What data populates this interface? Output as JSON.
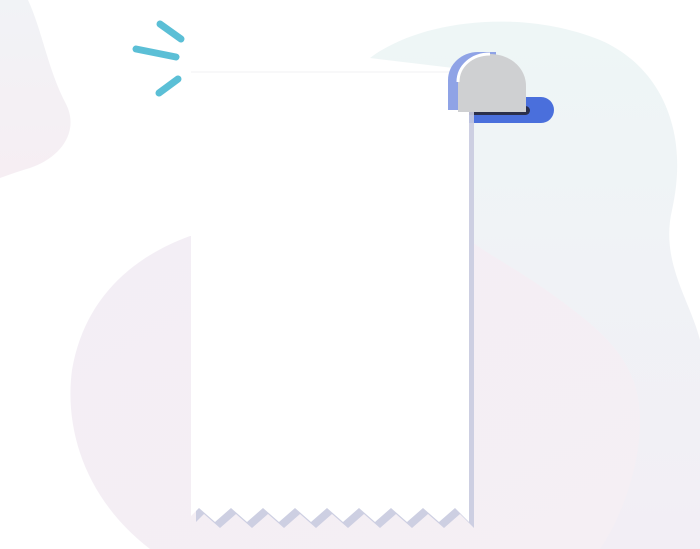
{
  "illustration": {
    "subject": "empty-receipt",
    "colors": {
      "background": "#ffffff",
      "blob_left": "#f3eef4",
      "blob_right": "#eef5f5",
      "blob_bottom": "#f4eef5",
      "receipt_paper": "#ffffff",
      "receipt_shadow": "#c9cbe0",
      "printer_slot": "#4a6fdc",
      "printer_slot_dark": "#2b2f4a",
      "printer_cap": "#cfd0d2",
      "printer_cap_back": "#8fa3e6",
      "spark_lines": "#5bbfd6"
    }
  }
}
